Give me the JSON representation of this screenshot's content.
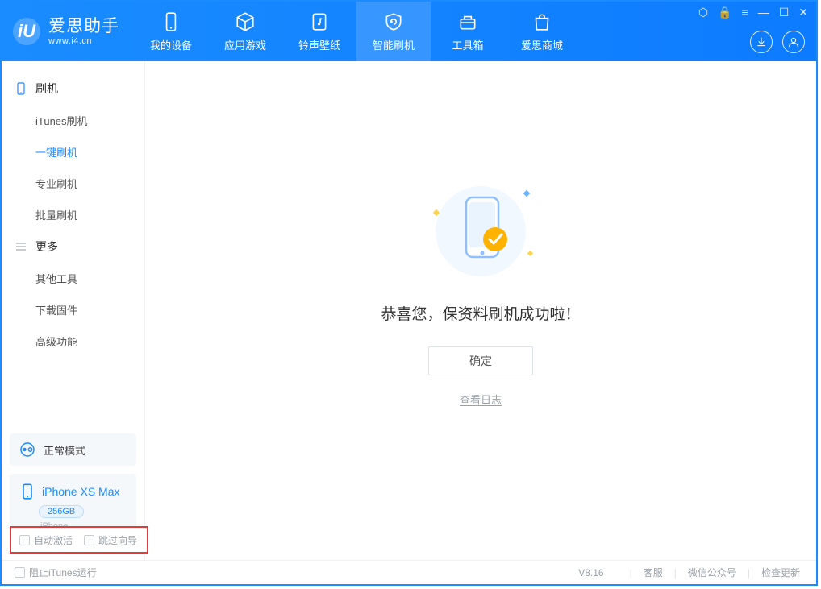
{
  "app": {
    "name": "爱思助手",
    "url": "www.i4.cn"
  },
  "tabs": [
    {
      "label": "我的设备"
    },
    {
      "label": "应用游戏"
    },
    {
      "label": "铃声壁纸"
    },
    {
      "label": "智能刷机"
    },
    {
      "label": "工具箱"
    },
    {
      "label": "爱思商城"
    }
  ],
  "sidebar": {
    "group1": {
      "title": "刷机",
      "items": [
        "iTunes刷机",
        "一键刷机",
        "专业刷机",
        "批量刷机"
      ]
    },
    "group2": {
      "title": "更多",
      "items": [
        "其他工具",
        "下载固件",
        "高级功能"
      ]
    }
  },
  "device": {
    "mode": "正常模式",
    "name": "iPhone XS Max",
    "capacity": "256GB",
    "model": "iPhone"
  },
  "highlight": {
    "auto_activate": "自动激活",
    "skip_guide": "跳过向导"
  },
  "content": {
    "message": "恭喜您，保资料刷机成功啦！",
    "ok": "确定",
    "log": "查看日志"
  },
  "status": {
    "stop_itunes": "阻止iTunes运行",
    "version": "V8.16",
    "links": [
      "客服",
      "微信公众号",
      "检查更新"
    ]
  }
}
